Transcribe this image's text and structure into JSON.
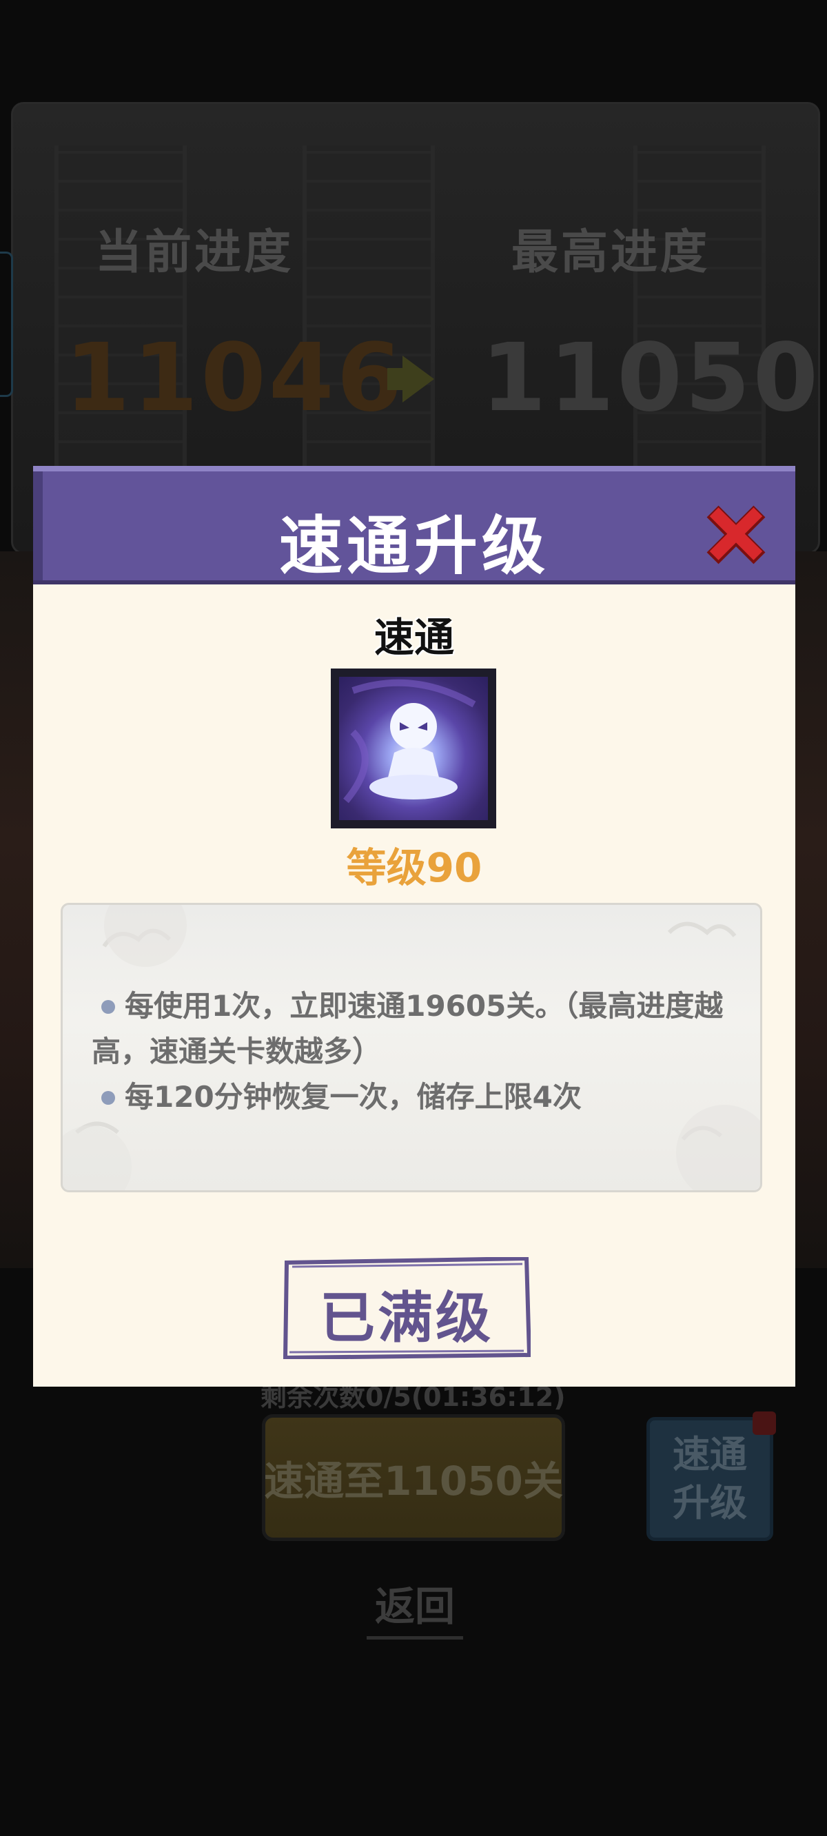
{
  "background": {
    "current_progress_label": "当前进度",
    "best_progress_label": "最高进度",
    "current_progress_value": "11046",
    "best_progress_value": "11050",
    "remaining_label": "剩余次数0/5(01:36:12)",
    "skip_button_label": "速通至11050关",
    "upgrade_button_label_line1": "速通",
    "upgrade_button_label_line2": "升级",
    "back_label": "返回"
  },
  "modal": {
    "title": "速通升级",
    "skill_name": "速通",
    "skill_level": "等级90",
    "description_line1": "每使用1次，立即速通19605关。（最高进度越高，速通关卡数越多）",
    "description_line2": "每120分钟恢复一次，储存上限4次",
    "maxed_button_label": "已满级"
  },
  "colors": {
    "header_purple": "#62549a",
    "level_orange": "#e9a23b",
    "close_red": "#d8282c",
    "body_cream": "#fdf7ea"
  },
  "icons": [
    "close-icon",
    "skill-speedrun-icon",
    "arrow-right-icon"
  ]
}
